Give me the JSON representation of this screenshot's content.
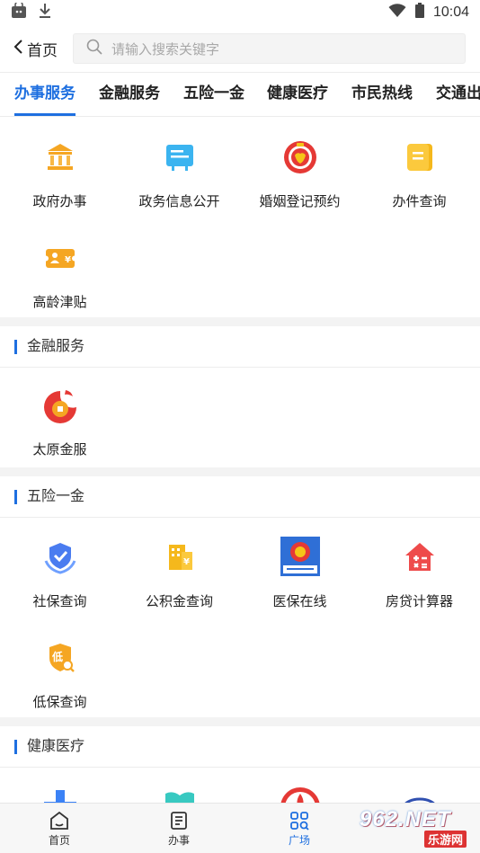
{
  "status_bar": {
    "time": "10:04"
  },
  "top_bar": {
    "back_label": "首页",
    "search_placeholder": "请输入搜索关键字"
  },
  "tabs": [
    {
      "label": "办事服务",
      "active": true
    },
    {
      "label": "金融服务",
      "active": false
    },
    {
      "label": "五险一金",
      "active": false
    },
    {
      "label": "健康医疗",
      "active": false
    },
    {
      "label": "市民热线",
      "active": false
    },
    {
      "label": "交通出",
      "active": false
    }
  ],
  "sections": {
    "banshi": {
      "items": [
        {
          "label": "政府办事",
          "icon": "government-building-icon"
        },
        {
          "label": "政务信息公开",
          "icon": "info-board-icon"
        },
        {
          "label": "婚姻登记预约",
          "icon": "marriage-registration-icon"
        },
        {
          "label": "办件查询",
          "icon": "document-query-icon"
        },
        {
          "label": "高龄津贴",
          "icon": "elderly-allowance-icon"
        }
      ]
    },
    "jinrong": {
      "title": "金融服务",
      "items": [
        {
          "label": "太原金服",
          "icon": "taiyuan-finance-logo-icon"
        }
      ]
    },
    "wuxian": {
      "title": "五险一金",
      "items": [
        {
          "label": "社保查询",
          "icon": "social-security-shield-icon"
        },
        {
          "label": "公积金查询",
          "icon": "housing-fund-icon"
        },
        {
          "label": "医保在线",
          "icon": "medical-insurance-emblem-icon"
        },
        {
          "label": "房贷计算器",
          "icon": "mortgage-calculator-icon"
        },
        {
          "label": "低保查询",
          "icon": "low-income-query-icon"
        }
      ]
    },
    "jiankang": {
      "title": "健康医疗"
    }
  },
  "bottom_nav": [
    {
      "label": "首页",
      "icon": "home-icon",
      "active": false
    },
    {
      "label": "办事",
      "icon": "form-list-icon",
      "active": false
    },
    {
      "label": "广场",
      "icon": "grid-search-icon",
      "active": true
    }
  ],
  "watermark": {
    "top": "962.NET",
    "bottom": "乐游网"
  },
  "colors": {
    "accent": "#1e6fe0",
    "orange": "#f5a623",
    "red": "#e53935"
  }
}
